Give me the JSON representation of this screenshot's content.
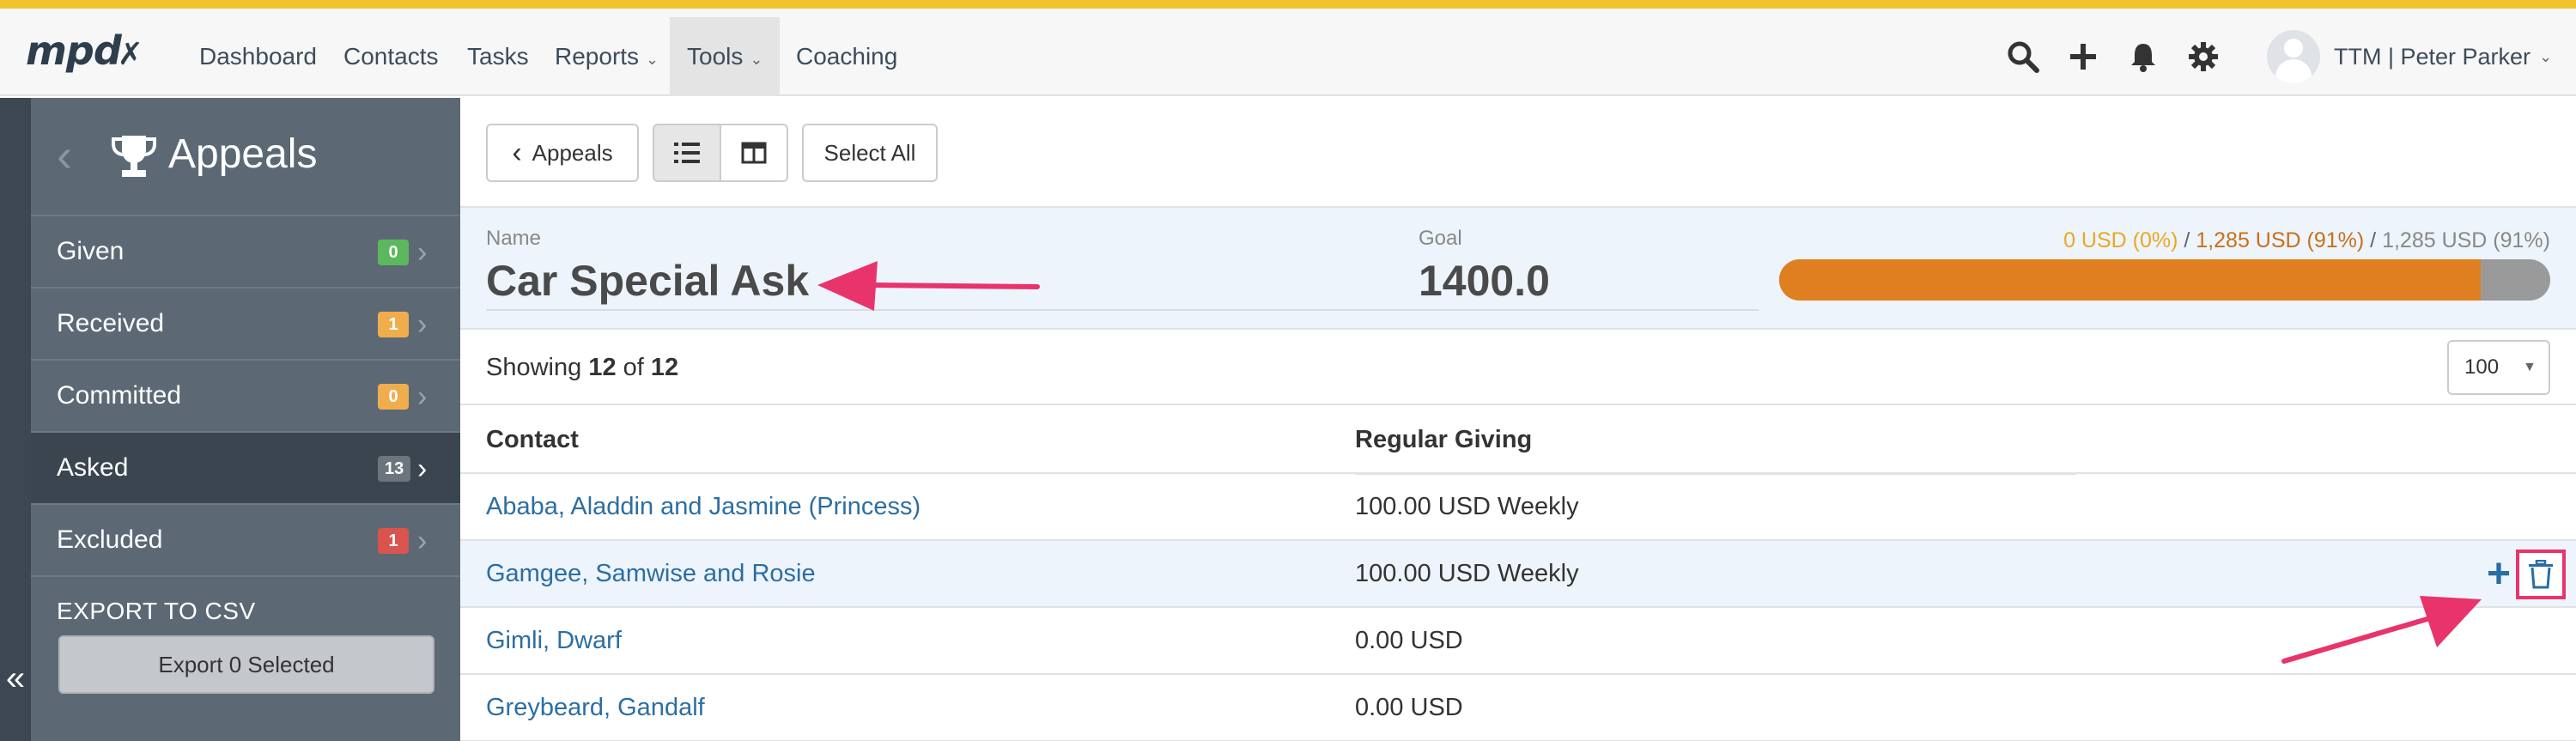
{
  "colors": {
    "accent": "#f2c230",
    "sidebar": "#5c6975",
    "link": "#2b6ea3",
    "progress_given": "#e9a825",
    "progress_received": "#e07f1f",
    "progress_committed": "#9a9a9a",
    "annotation": "#e8336b"
  },
  "nav": {
    "logo": "mpd",
    "items": [
      {
        "label": "Dashboard"
      },
      {
        "label": "Contacts"
      },
      {
        "label": "Tasks"
      },
      {
        "label": "Reports"
      },
      {
        "label": "Tools"
      },
      {
        "label": "Coaching"
      }
    ],
    "icons": [
      "search-icon",
      "plus-icon",
      "bell-icon",
      "gear-icon"
    ],
    "user": "TTM | Peter Parker"
  },
  "sidebar": {
    "title": "Appeals",
    "items": [
      {
        "label": "Given",
        "count": "0",
        "color": "#5cb85c"
      },
      {
        "label": "Received",
        "count": "1",
        "color": "#f0ad4e"
      },
      {
        "label": "Committed",
        "count": "0",
        "color": "#f0ad4e"
      },
      {
        "label": "Asked",
        "count": "13",
        "color": "#6c757d"
      },
      {
        "label": "Excluded",
        "count": "1",
        "color": "#d9534f"
      }
    ],
    "export_label": "EXPORT TO CSV",
    "export_button": "Export 0 Selected"
  },
  "toolbar": {
    "back_label": "Appeals",
    "select_all": "Select All"
  },
  "appeal": {
    "name_label": "Name",
    "name": "Car Special Ask",
    "goal_label": "Goal",
    "goal": "1400.0",
    "progress": {
      "given": "0 USD (0%)",
      "received": "1,285 USD (91%)",
      "committed": "1,285 USD (91%)",
      "separator": " / ",
      "fill_fraction": 0.91
    }
  },
  "list": {
    "showing_prefix": "Showing ",
    "shown": "12",
    "of_word": " of ",
    "total": "12",
    "per_page": "100",
    "columns": {
      "contact": "Contact",
      "giving": "Regular Giving"
    },
    "rows": [
      {
        "contact": "Ababa, Aladdin and Jasmine (Princess)",
        "giving": "100.00 USD Weekly"
      },
      {
        "contact": "Gamgee, Samwise and Rosie",
        "giving": "100.00 USD Weekly"
      },
      {
        "contact": "Gimli, Dwarf",
        "giving": "0.00 USD"
      },
      {
        "contact": "Greybeard, Gandalf",
        "giving": "0.00 USD"
      }
    ]
  }
}
